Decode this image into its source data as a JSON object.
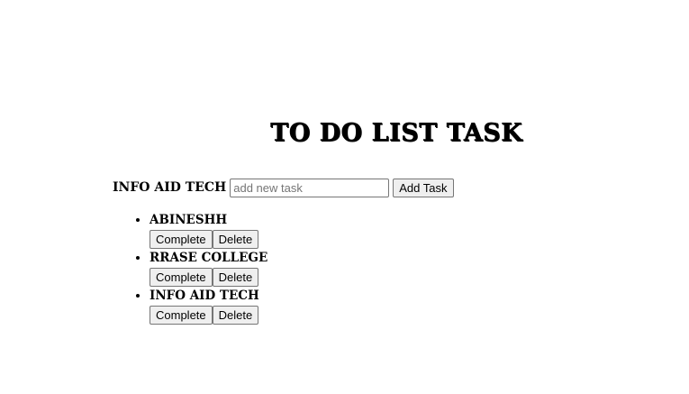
{
  "header": {
    "title": "TO DO LIST TASK"
  },
  "form": {
    "label": "INFO AID TECH",
    "input_placeholder": "add new task",
    "input_value": "",
    "add_button": "Add Task"
  },
  "tasks": [
    {
      "name": "ABINESHH",
      "complete_label": "Complete",
      "delete_label": "Delete"
    },
    {
      "name": "RRASE COLLEGE",
      "complete_label": "Complete",
      "delete_label": "Delete"
    },
    {
      "name": "INFO AID TECH",
      "complete_label": "Complete",
      "delete_label": "Delete"
    }
  ]
}
